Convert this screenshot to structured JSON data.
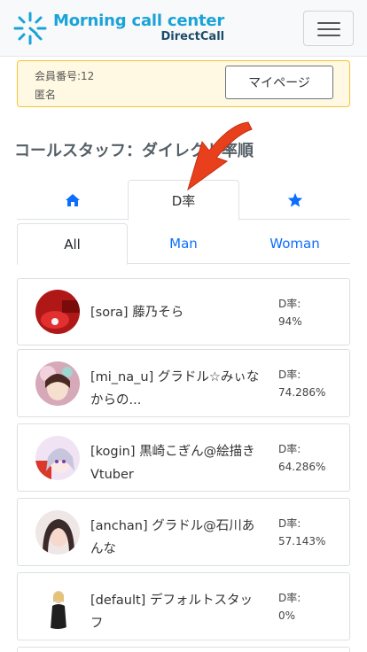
{
  "brand": {
    "title": "Morning call center",
    "subtitle": "DirectCall"
  },
  "member": {
    "number": "会員番号:12",
    "name": "匿名",
    "mypage_label": "マイページ"
  },
  "section_title": "コールスタッフ：ダイレクト率順",
  "tabs": [
    {
      "icon": "home-icon",
      "label": ""
    },
    {
      "label": "D率"
    },
    {
      "icon": "star-icon",
      "label": ""
    }
  ],
  "subtabs": [
    {
      "label": "All"
    },
    {
      "label": "Man"
    },
    {
      "label": "Woman"
    }
  ],
  "staff": [
    {
      "name": "[sora] 藤乃そら",
      "rate_label": "D率:",
      "rate": "94%"
    },
    {
      "name": "[mi_na_u] グラドル☆みぃなからの...",
      "rate_label": "D率:",
      "rate": "74.286%"
    },
    {
      "name": "[kogin] 黒崎こぎん@絵描きVtuber",
      "rate_label": "D率:",
      "rate": "64.286%"
    },
    {
      "name": "[anchan] グラドル@石川あんな",
      "rate_label": "D率:",
      "rate": "57.143%"
    },
    {
      "name": "[default] デフォルトスタッフ",
      "rate_label": "D率:",
      "rate": "0%"
    }
  ],
  "colors": {
    "brand": "#1aa3d8",
    "link": "#0d6efd",
    "member_border": "#f4c430",
    "annotation_arrow": "#e8401c"
  }
}
